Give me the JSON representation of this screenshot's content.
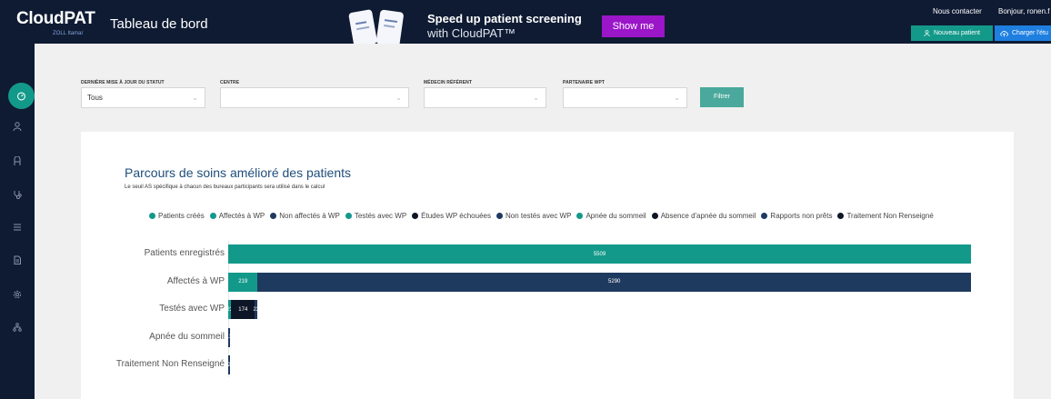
{
  "header": {
    "logo": "CloudPAT",
    "logo_sub": "ZOLL Itamar",
    "title": "Tableau de bord",
    "promo_title": "Speed up patient screening",
    "promo_sub": "with CloudPAT™",
    "promo_button": "Show me",
    "contact": "Nous contacter",
    "greeting": "Bonjour, ronen.f",
    "new_patient": "Nouveau patient",
    "upload": "Charger l'étu"
  },
  "sidebar": {
    "icons": [
      "dashboard-icon",
      "user-icon",
      "users-icon",
      "stethoscope-icon",
      "list-icon",
      "document-icon",
      "settings-icon",
      "network-icon"
    ]
  },
  "filters": {
    "status_label": "DERNIÈRE MISE À JOUR DU STATUT",
    "status_value": "Tous",
    "center_label": "CENTRE",
    "center_value": "",
    "doctor_label": "MÉDECIN RÉFÉRENT",
    "doctor_value": "",
    "partner_label": "PARTENAIRE WPT",
    "partner_value": "",
    "button": "Filtrer"
  },
  "panel": {
    "title": "Parcours de soins amélioré des patients",
    "description": "Le seuil AS spécifique à chacun des bureaux participants sera utilisé dans le calcul"
  },
  "colors": {
    "teal": "#13998a",
    "navy": "#1f3a5f",
    "black": "#0d1626"
  },
  "chart_data": {
    "type": "bar",
    "orientation": "horizontal",
    "stacked": true,
    "legend": [
      {
        "name": "Patients créés",
        "color": "#13998a"
      },
      {
        "name": "Affectés à WP",
        "color": "#13998a"
      },
      {
        "name": "Non affectés à WP",
        "color": "#1f3a5f"
      },
      {
        "name": "Testés avec WP",
        "color": "#13998a"
      },
      {
        "name": "Études WP échouées",
        "color": "#0d1626"
      },
      {
        "name": "Non testés avec WP",
        "color": "#1f3a5f"
      },
      {
        "name": "Apnée du sommeil",
        "color": "#13998a"
      },
      {
        "name": "Absence d'apnée du sommeil",
        "color": "#0d1626"
      },
      {
        "name": "Rapports non prêts",
        "color": "#1f3a5f"
      },
      {
        "name": "Traitement Non Renseigné",
        "color": "#0d1626"
      }
    ],
    "categories": [
      "Patients enregistrés",
      "Affectés à WP",
      "Testés avec WP",
      "Apnée du sommeil",
      "Traitement Non Renseigné"
    ],
    "rows": [
      {
        "segments": [
          {
            "value": 5509,
            "label": "5509",
            "color": "#13998a"
          }
        ]
      },
      {
        "segments": [
          {
            "value": 219,
            "label": "219",
            "color": "#13998a"
          },
          {
            "value": 5290,
            "label": "5290",
            "color": "#1f3a5f"
          }
        ]
      },
      {
        "segments": [
          {
            "value": 23,
            "label": "23",
            "color": "#13998a"
          },
          {
            "value": 174,
            "label": "174",
            "color": "#0d1626"
          },
          {
            "value": 22,
            "label": "22",
            "color": "#1f3a5f"
          }
        ]
      },
      {
        "segments": [
          {
            "value": 13,
            "label": "13",
            "color": "#1f3a5f"
          }
        ]
      },
      {
        "segments": [
          {
            "value": 2,
            "label": "2",
            "color": "#1f3a5f"
          }
        ]
      }
    ],
    "xlim": [
      0,
      5509
    ]
  }
}
